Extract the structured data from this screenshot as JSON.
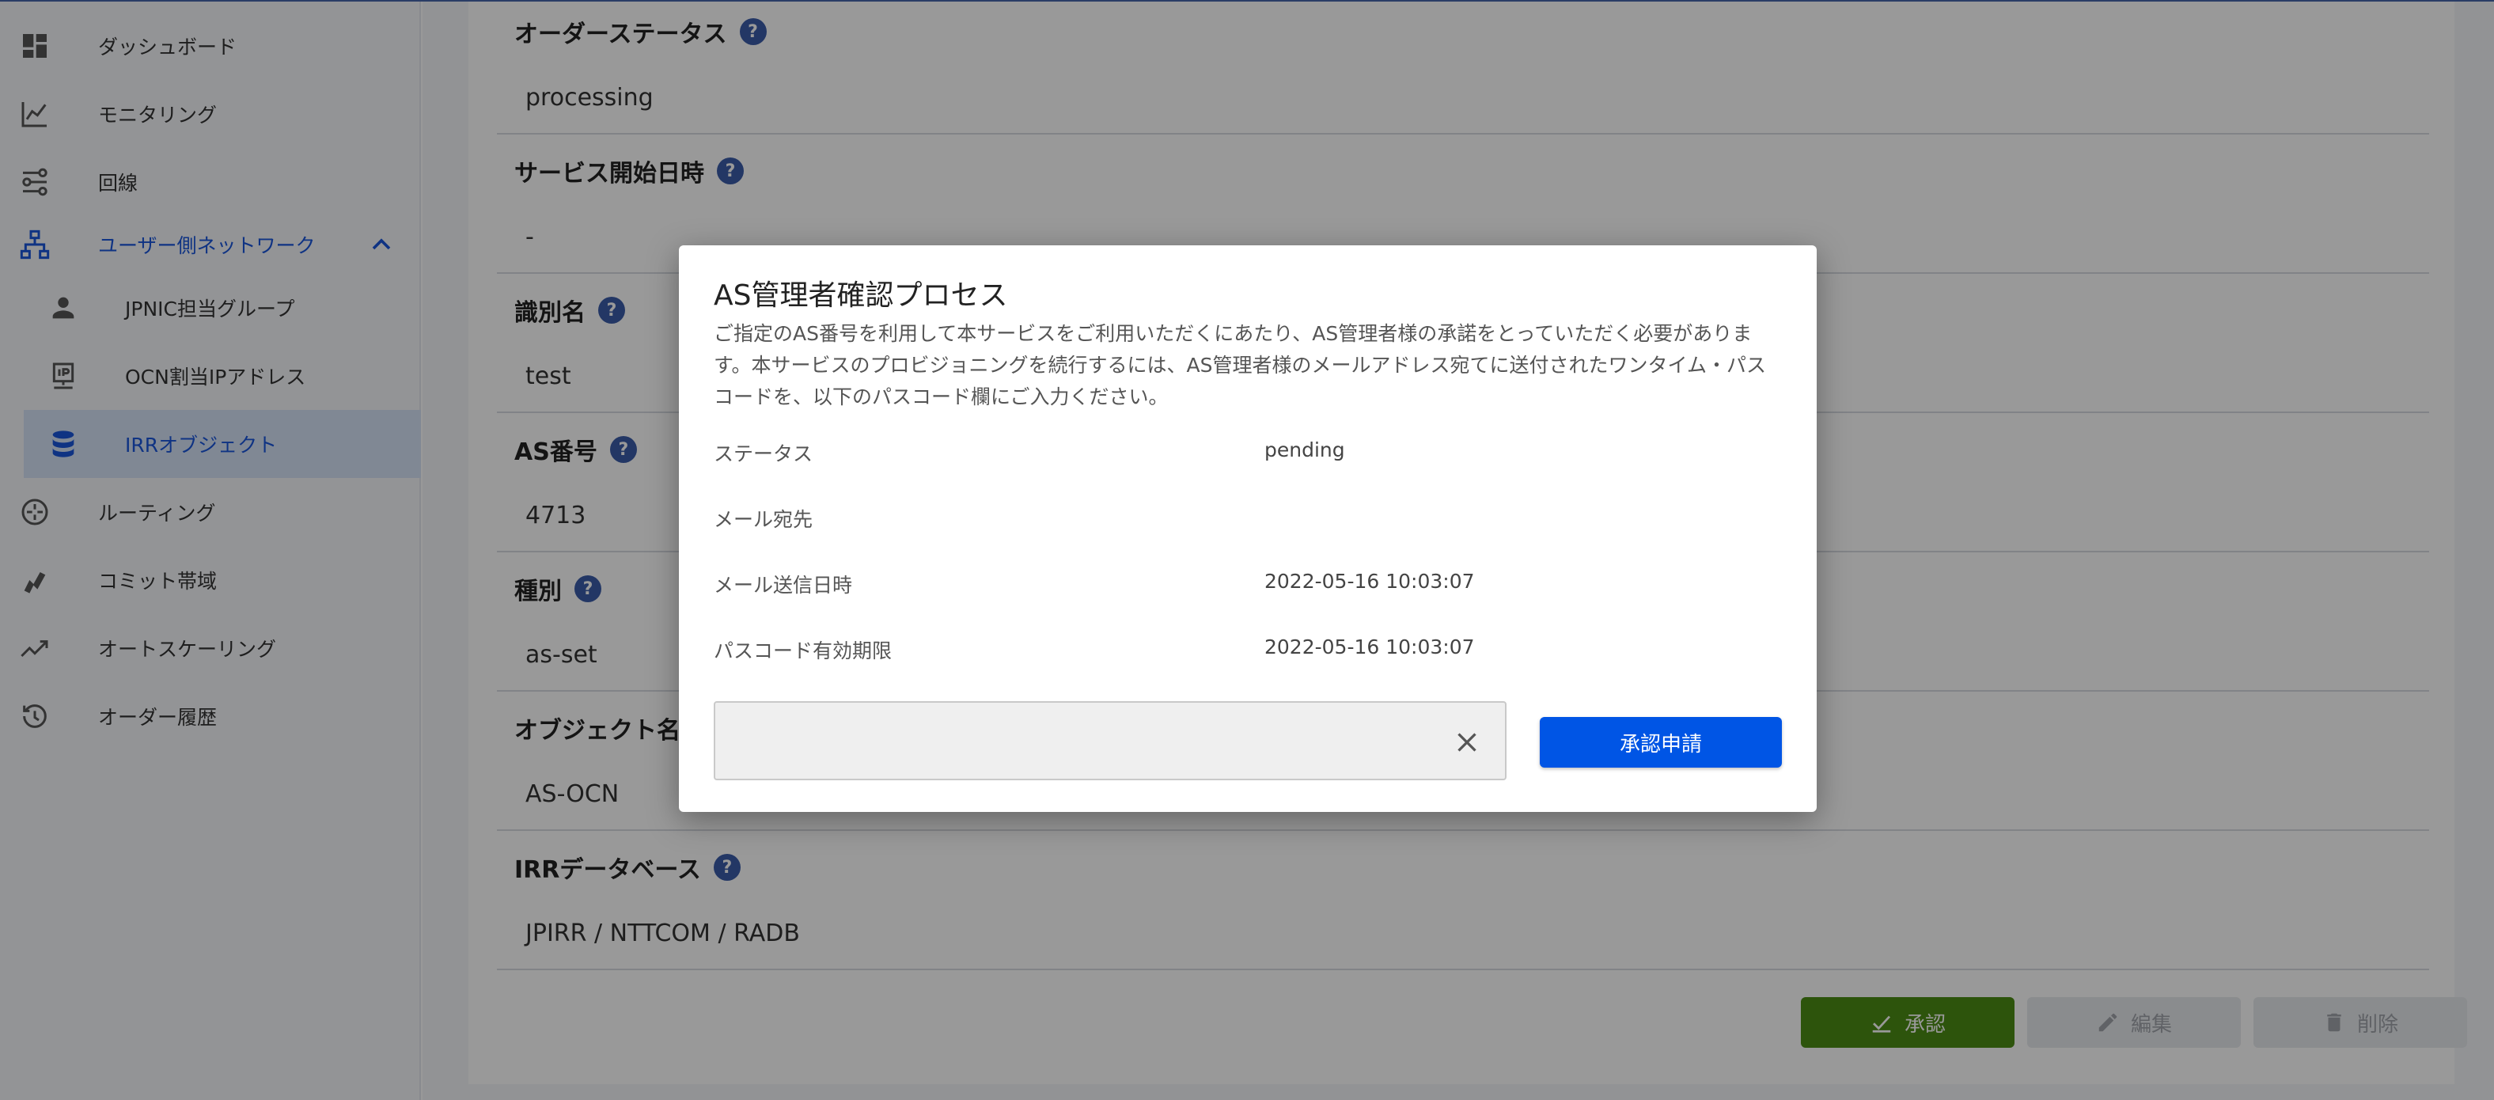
{
  "sidebar": {
    "items": [
      {
        "label": "ダッシュボード",
        "icon": "dashboard-icon"
      },
      {
        "label": "モニタリング",
        "icon": "line-chart-icon"
      },
      {
        "label": "回線",
        "icon": "route-icon"
      },
      {
        "label": "ユーザー側ネットワーク",
        "icon": "network-icon"
      },
      {
        "label": "JPNIC担当グループ",
        "icon": "person-icon"
      },
      {
        "label": "OCN割当IPアドレス",
        "icon": "ip-address-icon"
      },
      {
        "label": "IRRオブジェクト",
        "icon": "database-icon"
      },
      {
        "label": "ルーティング",
        "icon": "routing-icon"
      },
      {
        "label": "コミット帯域",
        "icon": "bandwidth-icon"
      },
      {
        "label": "オートスケーリング",
        "icon": "autoscale-icon"
      },
      {
        "label": "オーダー履歴",
        "icon": "history-icon"
      }
    ]
  },
  "fields": [
    {
      "label": "オーダーステータス",
      "value": "processing"
    },
    {
      "label": "サービス開始日時",
      "value": "-"
    },
    {
      "label": "識別名",
      "value": "test"
    },
    {
      "label": "AS番号",
      "value": "4713"
    },
    {
      "label": "種別",
      "value": "as-set"
    },
    {
      "label": "オブジェクト名",
      "value": "AS-OCN"
    },
    {
      "label": "IRRデータベース",
      "value": "JPIRR / NTTCOM / RADB"
    }
  ],
  "help_glyph": "?",
  "actions": {
    "approve": "承認",
    "edit": "編集",
    "delete": "削除"
  },
  "modal": {
    "title": "AS管理者確認プロセス",
    "description": "ご指定のAS番号を利用して本サービスをご利用いただくにあたり、AS管理者様の承諾をとっていただく必要があります。本サービスのプロビジョニングを続行するには、AS管理者様のメールアドレス宛てに送付されたワンタイム・パスコードを、以下のパスコード欄にご入力ください。",
    "rows": [
      {
        "key": "ステータス",
        "value": "pending"
      },
      {
        "key": "メール宛先",
        "value": ""
      },
      {
        "key": "メール送信日時",
        "value": "2022-05-16 10:03:07"
      },
      {
        "key": "パスコード有効期限",
        "value": "2022-05-16 10:03:07"
      }
    ],
    "passcode_value": "",
    "submit_label": "承認申請"
  },
  "colors": {
    "accent": "#1a56db",
    "approve": "#4c8c14",
    "submit": "#0055e5"
  }
}
